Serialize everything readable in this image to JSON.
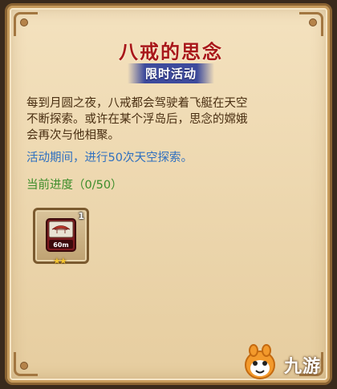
{
  "panel": {
    "title": "八戒的思念",
    "subtitle": "限时活动",
    "description_lines": [
      "每到月圆之夜，八戒都会驾驶着飞艇在天空",
      "不断探索。或许在某个浮岛后，思念的嫦娥",
      "会再次与他相聚。"
    ],
    "period_text": "活动期间，进行50次天空探索。",
    "progress_text": "当前进度（0/50）"
  },
  "reward": {
    "count": "1",
    "icon_label": "60m",
    "icon": "airship-ticket-icon",
    "stars": 2,
    "stars_glyph": "★★"
  },
  "watermark": {
    "text": "九游",
    "icon": "jiuyou-mascot-icon"
  },
  "colors": {
    "title": "#a8171a",
    "subtitle_bg": "#3d4a9c",
    "body_text": "#4a2f12",
    "period_text": "#2f70c0",
    "progress_text": "#3c8d2a",
    "panel_bg": "#f4e2bf",
    "border": "#8a6332"
  }
}
